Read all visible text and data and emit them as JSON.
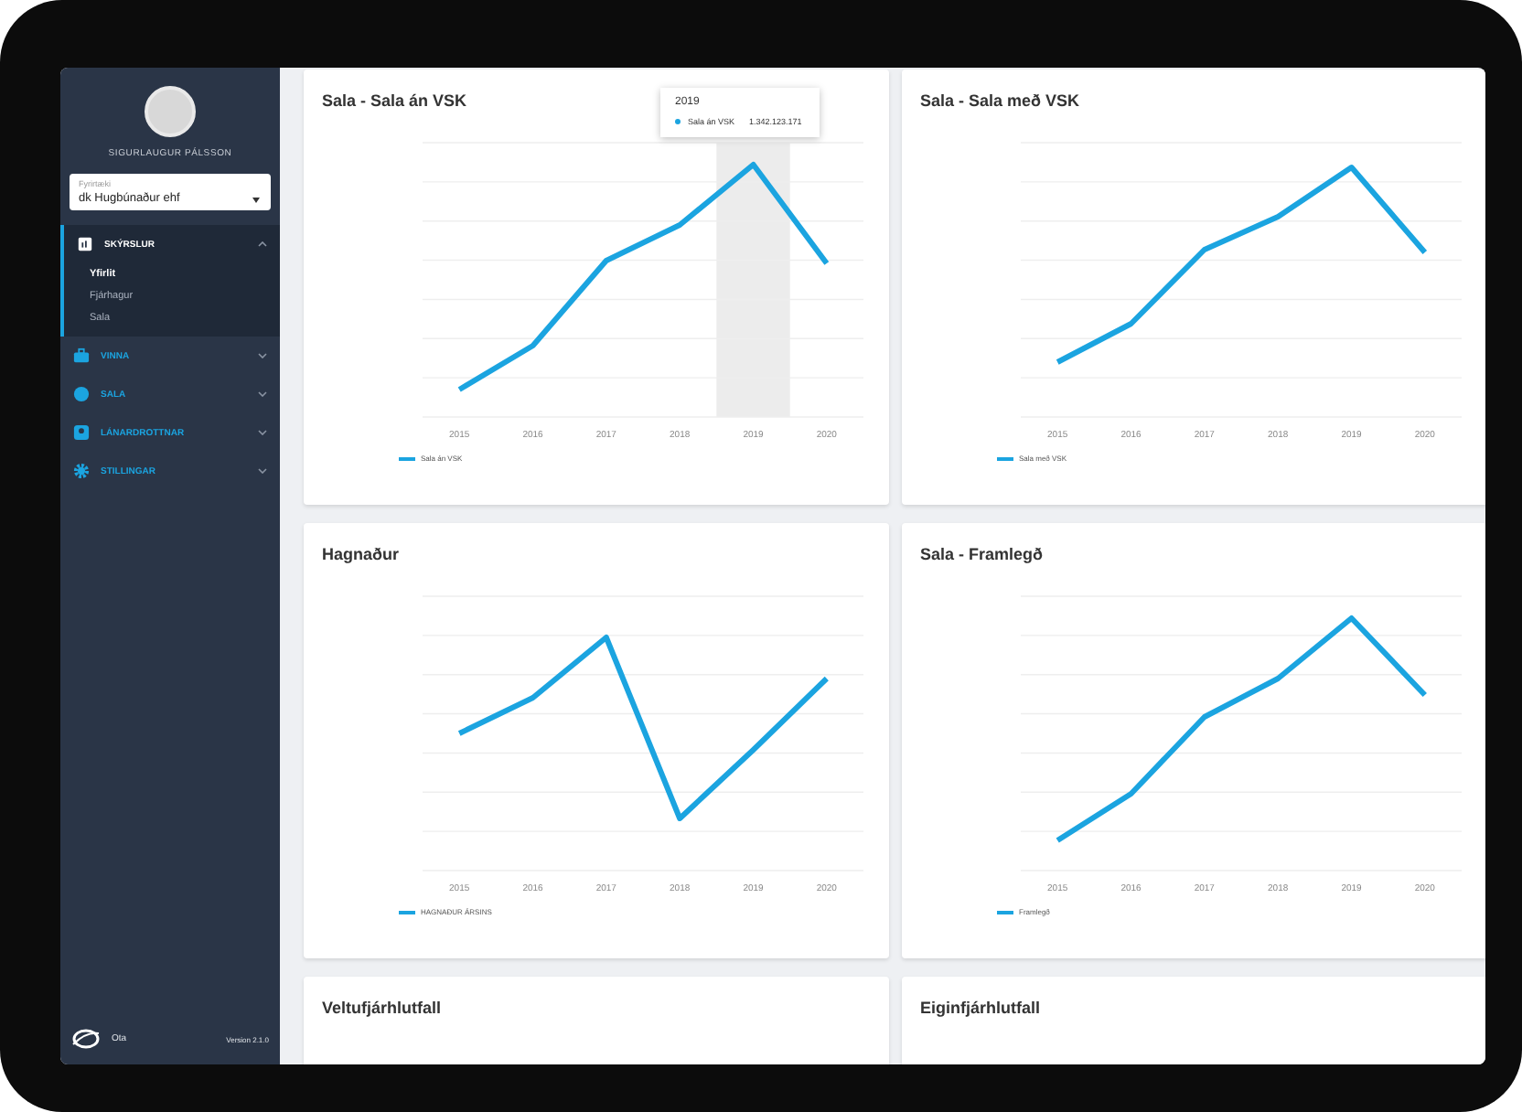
{
  "sidebar": {
    "user_name": "SIGURLAUGUR PÁLSSON",
    "company_field": {
      "label": "Fyrirtæki",
      "value": "dk Hugbúnaður ehf"
    },
    "menu": [
      {
        "label": "SKÝRSLUR",
        "kind": "report",
        "expanded": true,
        "children": [
          {
            "label": "Yfirlit",
            "selected": true
          },
          {
            "label": "Fjárhagur",
            "selected": false
          },
          {
            "label": "Sala",
            "selected": false
          }
        ]
      },
      {
        "label": "VINNA",
        "kind": "briefcase",
        "expanded": false
      },
      {
        "label": "SALA",
        "kind": "money",
        "expanded": false
      },
      {
        "label": "LÁNARDROTTNAR",
        "kind": "person",
        "expanded": false
      },
      {
        "label": "STILLINGAR",
        "kind": "gear",
        "expanded": false
      }
    ],
    "footer": {
      "app_name": "Ota",
      "version": "Version 2.1.0"
    }
  },
  "cards": [
    {
      "title": "Sala - Sala án VSK",
      "legend": "Sala án VSK",
      "categories": [
        {
          "label": "2015",
          "hovered": false
        },
        {
          "label": "2016",
          "hovered": false
        },
        {
          "label": "2017",
          "hovered": false
        },
        {
          "label": "2018",
          "hovered": false
        },
        {
          "label": "2019",
          "hovered": true
        },
        {
          "label": "2020",
          "hovered": false
        }
      ],
      "tooltip": {
        "title": "2019",
        "series": "Sala án VSK",
        "value": "1.342.123.171"
      }
    },
    {
      "title": "Sala - Sala með VSK",
      "legend": "Sala með VSK",
      "categories": [
        {
          "label": "2015",
          "hovered": false
        },
        {
          "label": "2016",
          "hovered": false
        },
        {
          "label": "2017",
          "hovered": false
        },
        {
          "label": "2018",
          "hovered": false
        },
        {
          "label": "2019",
          "hovered": false
        },
        {
          "label": "2020",
          "hovered": false
        }
      ]
    },
    {
      "title": "Hagnaður",
      "legend": "HAGNAÐUR ÁRSINS",
      "categories": [
        {
          "label": "2015",
          "hovered": false
        },
        {
          "label": "2016",
          "hovered": false
        },
        {
          "label": "2017",
          "hovered": false
        },
        {
          "label": "2018",
          "hovered": false
        },
        {
          "label": "2019",
          "hovered": false
        },
        {
          "label": "2020",
          "hovered": false
        }
      ]
    },
    {
      "title": "Sala - Framlegð",
      "legend": "Framlegð",
      "categories": [
        {
          "label": "2015",
          "hovered": false
        },
        {
          "label": "2016",
          "hovered": false
        },
        {
          "label": "2017",
          "hovered": false
        },
        {
          "label": "2018",
          "hovered": false
        },
        {
          "label": "2019",
          "hovered": false
        },
        {
          "label": "2020",
          "hovered": false
        }
      ]
    },
    {
      "title": "Veltufjárhlutfall"
    },
    {
      "title": "Eiginfjárhlutfall"
    }
  ]
}
